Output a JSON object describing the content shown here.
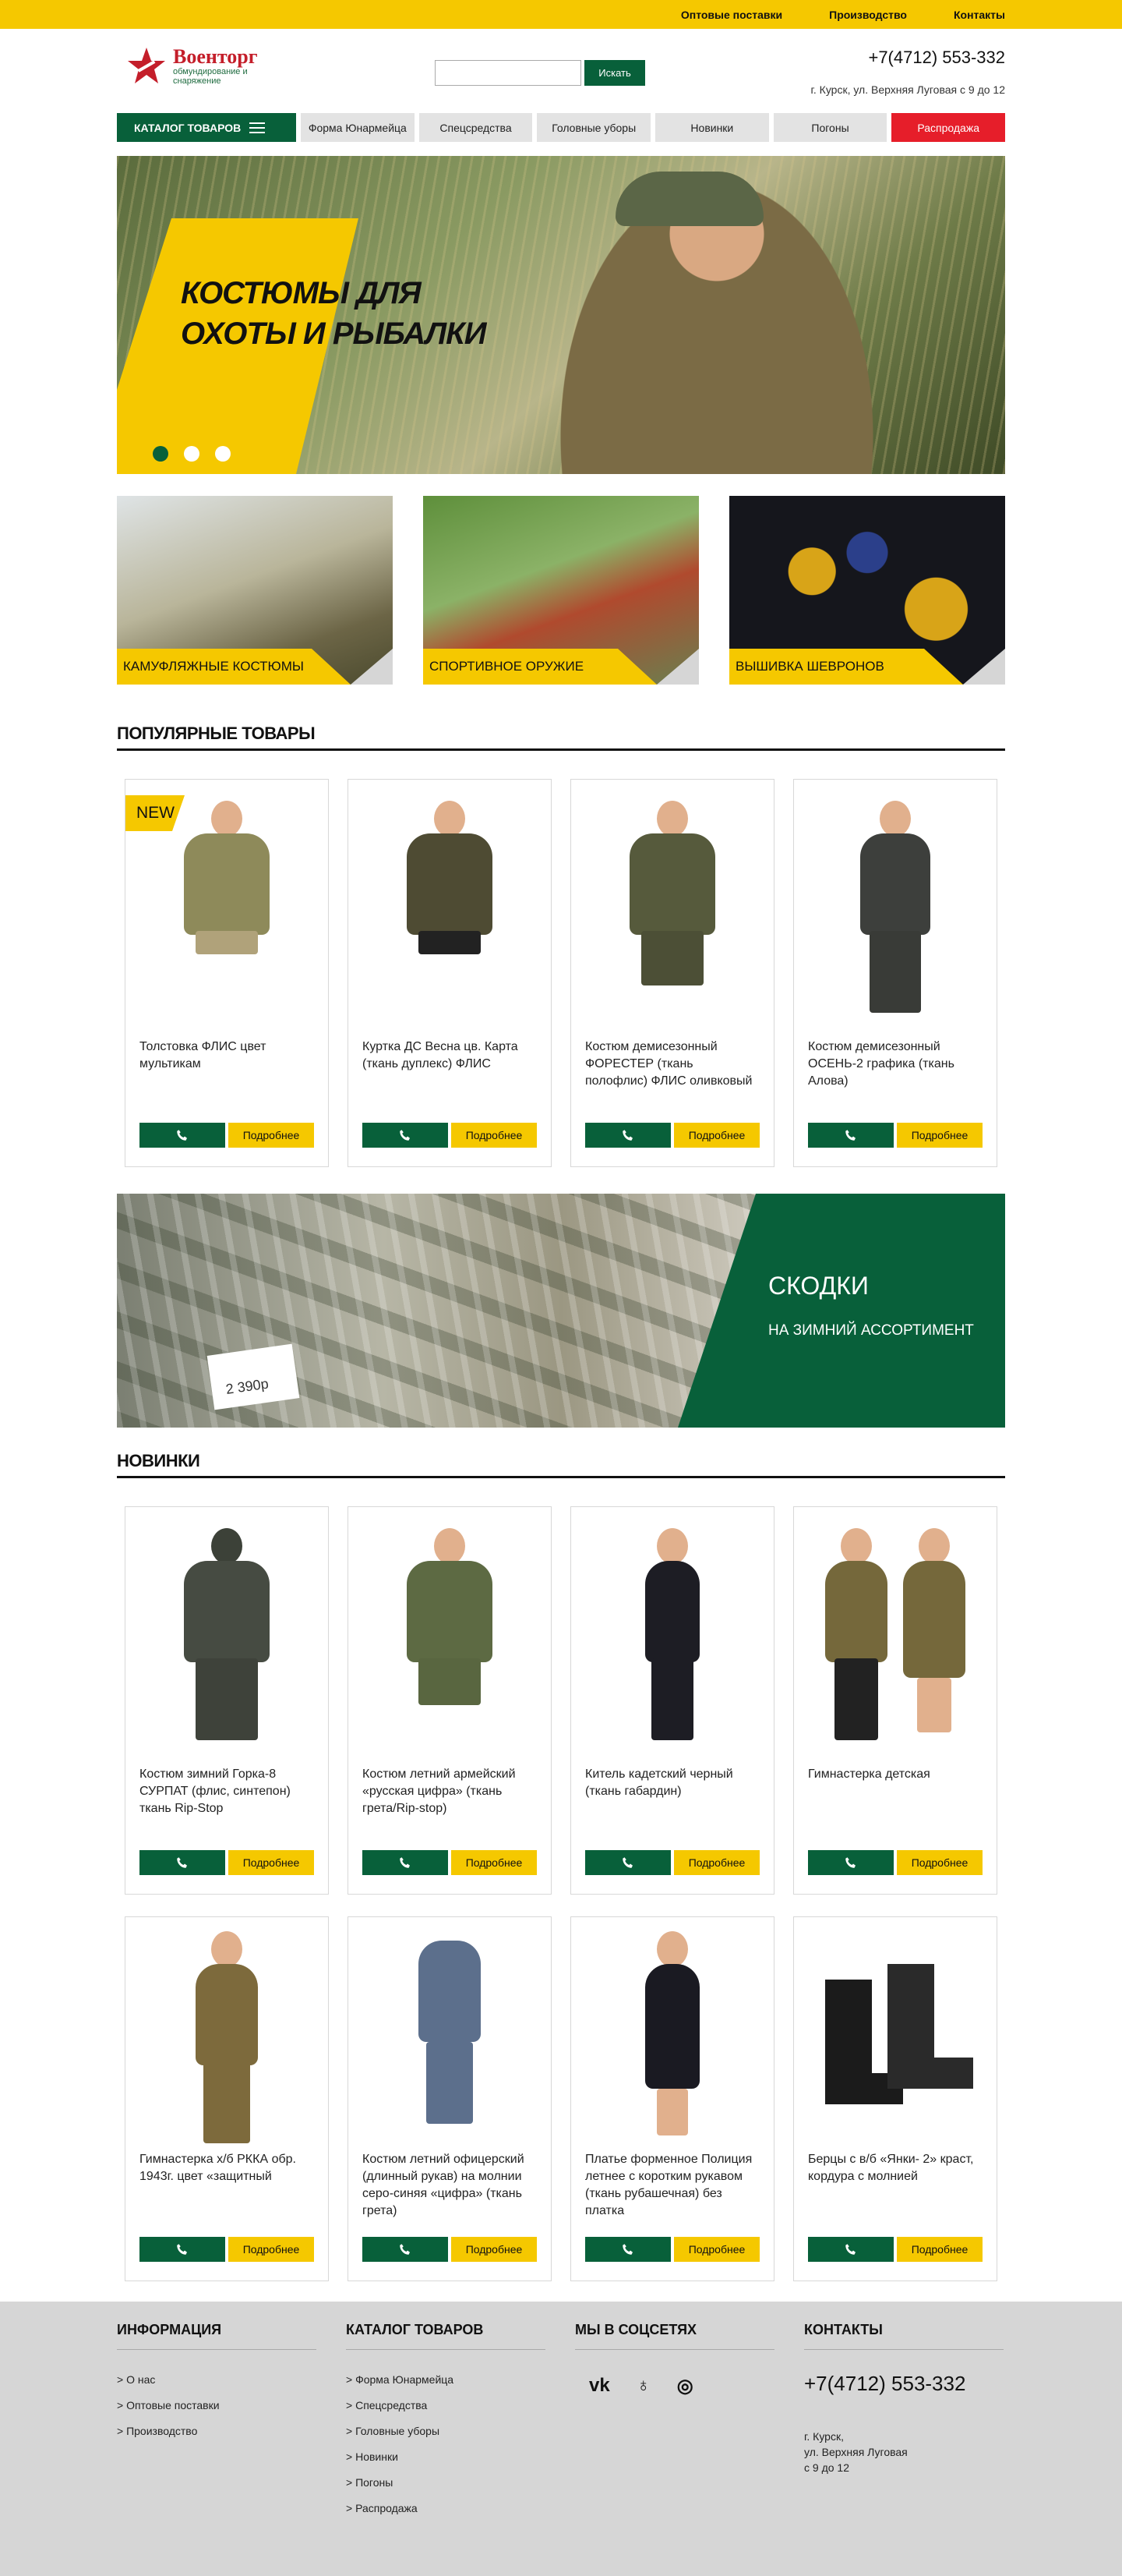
{
  "topbar": {
    "links": [
      "Оптовые поставки",
      "Производство",
      "Контакты"
    ]
  },
  "header": {
    "logo_title": "Военторг",
    "logo_sub": "обмундирование и снаряжение",
    "search_placeholder": "",
    "search_button": "Искать",
    "phone": "+7(4712) 553-332",
    "address": "г. Курск, ул. Верхняя Луговая с 9 до 12"
  },
  "nav": {
    "catalog": "КАТАЛОГ ТОВАРОВ",
    "items": [
      "Форма Юнармейца",
      "Спецсредства",
      "Головные уборы",
      "Новинки",
      "Погоны",
      "Распродажа"
    ]
  },
  "hero": {
    "title_line1": "КОСТЮМЫ ДЛЯ",
    "title_line2": "ОХОТЫ И РЫБАЛКИ"
  },
  "categories": [
    "КАМУФЛЯЖНЫЕ КОСТЮМЫ",
    "СПОРТИВНОЕ ОРУЖИЕ",
    "ВЫШИВКА ШЕВРОНОВ"
  ],
  "popular": {
    "title": "ПОПУЛЯРНЫЕ ТОВАРЫ",
    "new_badge": "NEW",
    "more_label": "Подробнее",
    "items": [
      "Толстовка ФЛИС цвет мультикам",
      "Куртка ДС Весна цв. Карта (ткань дуплекс) ФЛИС",
      "Костюм демисезонный ФОРЕСТЕР (ткань полофлис) ФЛИС оливковый",
      "Костюм демисезонный ОСЕНЬ-2 графика (ткань Алова)"
    ]
  },
  "banner": {
    "title": "СКОДКИ",
    "subtitle": "НА ЗИМНИЙ АССОРТИМЕНТ",
    "price_tag": "2 390р"
  },
  "novelties": {
    "title": "НОВИНКИ",
    "row1": [
      "Костюм зимний Горка-8 СУРПАТ (флис, синтепон) ткань Rip-Stop",
      "Костюм летний армейский «русская цифра» (ткань грета/Rip-stop)",
      "Китель кадетский черный (ткань габардин)",
      "Гимнастерка детская"
    ],
    "row2": [
      "Гимнастерка х/б РККА обр. 1943г. цвет «защитный",
      "Костюм летний офицерский (длинный рукав) на молнии серо-синяя «цифра» (ткань грета)",
      "Платье форменное Полиция летнее с коротким рукавом (ткань рубашечная) без платка",
      "Берцы с в/б «Янки- 2» краст, кордура с молнией"
    ]
  },
  "footer": {
    "info_title": "ИНФОРМАЦИЯ",
    "info_links": [
      "О нас",
      "Оптовые поставки",
      "Производство"
    ],
    "catalog_title": "КАТАЛОГ ТОВАРОВ",
    "catalog_links": [
      "Форма Юнармейца",
      "Спецсредства",
      "Головные уборы",
      "Новинки",
      "Погоны",
      "Распродажа"
    ],
    "social_title": "МЫ В СОЦСЕТЯХ",
    "social": [
      "vk-icon",
      "odnoklassniki-icon",
      "instagram-icon"
    ],
    "contacts_title": "КОНТАКТЫ",
    "phone": "+7(4712) 553-332",
    "addr1": "г. Курск,",
    "addr2": "ул. Верхняя Луговая",
    "addr3": "с 9 до 12"
  },
  "colors": {
    "accent_yellow": "#f5c800",
    "brand_green": "#08603a",
    "sale_red": "#e61e2a"
  }
}
